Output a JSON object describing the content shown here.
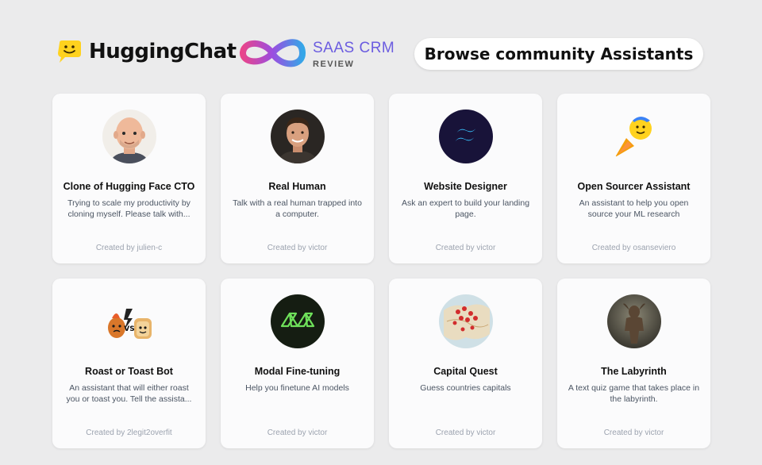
{
  "header": {
    "app_name": "HuggingChat",
    "partner_logo": {
      "line1": "SAAS CRM",
      "line2": "REVIEW"
    },
    "browse_label": "Browse community Assistants"
  },
  "colors": {
    "page_bg": "#ebebec",
    "card_bg": "#fbfbfc",
    "accent_purple": "#6b5ce0"
  },
  "assistants": [
    {
      "name": "Clone of Hugging Face CTO",
      "description": "Trying to scale my productivity by cloning myself. Please talk with...",
      "creator": "Created by julien-c",
      "avatar_icon": "bald-memoji-avatar"
    },
    {
      "name": "Real Human",
      "description": "Talk with a real human trapped into a computer.",
      "creator": "Created by victor",
      "avatar_icon": "human-photo-avatar"
    },
    {
      "name": "Website Designer",
      "description": "Ask an expert to build your landing page.",
      "creator": "Created by victor",
      "avatar_icon": "tailwind-logo-avatar"
    },
    {
      "name": "Open Sourcer Assistant",
      "description": "An assistant to help you open source your ML research",
      "creator": "Created by osanseviero",
      "avatar_icon": "rocket-hugging-face-avatar"
    },
    {
      "name": "Roast or Toast Bot",
      "description": "An assistant that will either roast you or toast you. Tell the assista...",
      "creator": "Created by 2legit2overfit",
      "avatar_icon": "roast-vs-toast-avatar"
    },
    {
      "name": "Modal Fine-tuning",
      "description": "Help you finetune AI models",
      "creator": "Created by victor",
      "avatar_icon": "modal-logo-avatar"
    },
    {
      "name": "Capital Quest",
      "description": "Guess countries capitals",
      "creator": "Created by victor",
      "avatar_icon": "map-pins-avatar"
    },
    {
      "name": "The Labyrinth",
      "description": "A text quiz game that takes place in the labyrinth.",
      "creator": "Created by victor",
      "avatar_icon": "minotaur-avatar"
    }
  ]
}
